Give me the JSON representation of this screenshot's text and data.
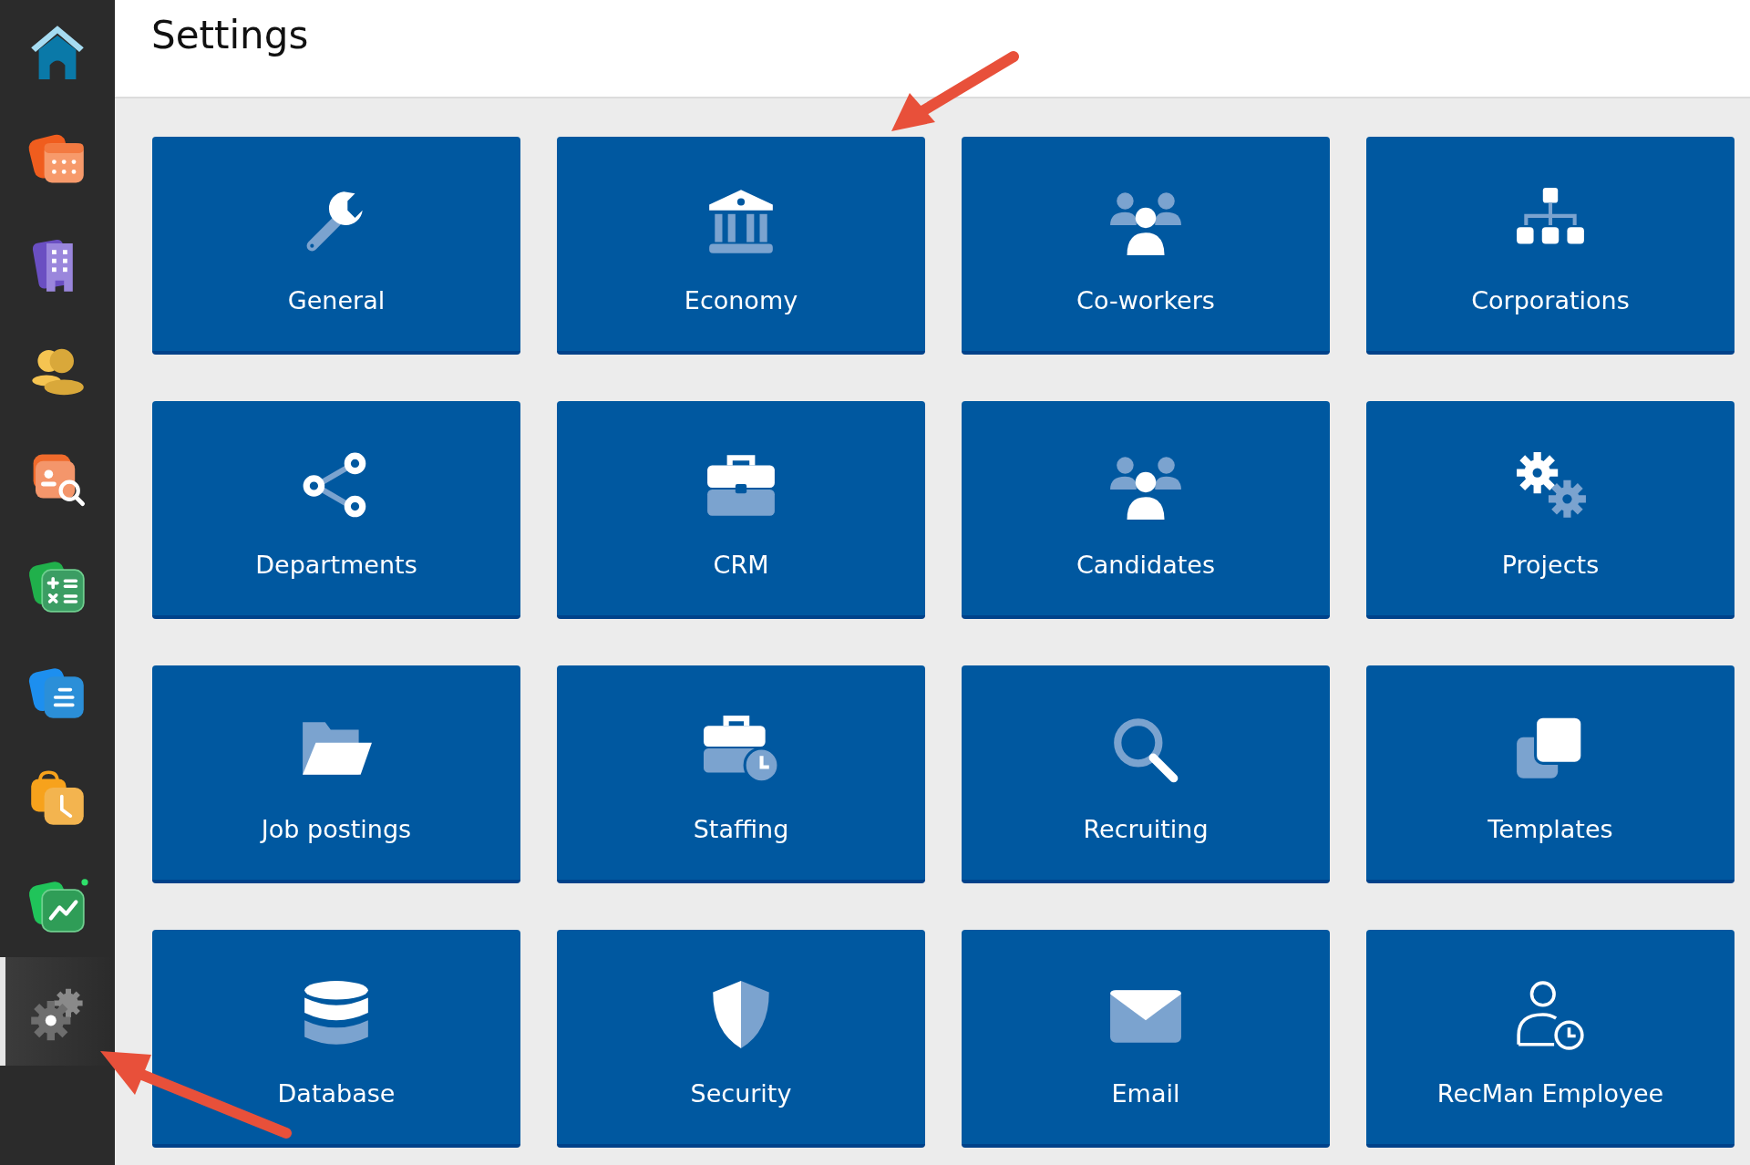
{
  "sidebar": {
    "items": [
      {
        "kind": "home",
        "selected": false
      },
      {
        "kind": "calendar",
        "selected": false
      },
      {
        "kind": "building",
        "selected": false
      },
      {
        "kind": "coins",
        "selected": false
      },
      {
        "kind": "contact-search",
        "selected": false
      },
      {
        "kind": "calculator",
        "selected": false
      },
      {
        "kind": "document",
        "selected": false
      },
      {
        "kind": "clock-bag",
        "selected": false
      },
      {
        "kind": "chart",
        "selected": false
      },
      {
        "kind": "gear",
        "selected": true
      }
    ]
  },
  "header": {
    "title": "Settings"
  },
  "tiles": [
    {
      "label": "General",
      "kind": "wrench"
    },
    {
      "label": "Economy",
      "kind": "bank"
    },
    {
      "label": "Co-workers",
      "kind": "users"
    },
    {
      "label": "Corporations",
      "kind": "org"
    },
    {
      "label": "Departments",
      "kind": "share"
    },
    {
      "label": "CRM",
      "kind": "briefcase"
    },
    {
      "label": "Candidates",
      "kind": "users"
    },
    {
      "label": "Projects",
      "kind": "gears"
    },
    {
      "label": "Job postings",
      "kind": "folder"
    },
    {
      "label": "Staffing",
      "kind": "briefcase-clock"
    },
    {
      "label": "Recruiting",
      "kind": "search"
    },
    {
      "label": "Templates",
      "kind": "clone"
    },
    {
      "label": "Database",
      "kind": "database"
    },
    {
      "label": "Security",
      "kind": "shield"
    },
    {
      "label": "Email",
      "kind": "envelope"
    },
    {
      "label": "RecMan Employee",
      "kind": "user-clock"
    }
  ]
}
